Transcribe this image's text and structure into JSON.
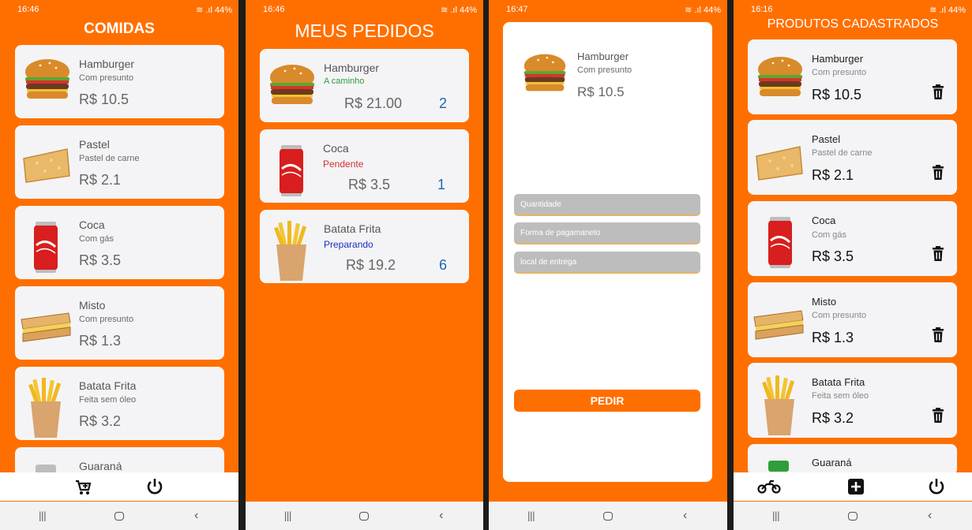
{
  "system_nav": {
    "recents": "|||",
    "back": "‹"
  },
  "screen1": {
    "time": "16:46",
    "signal": "≋ .ıl 44%",
    "title": "COMIDAS",
    "items": [
      {
        "name": "Hamburger",
        "desc": "Com presunto",
        "price": "R$ 10.5",
        "icon": "burger"
      },
      {
        "name": "Pastel",
        "desc": "Pastel de carne",
        "price": "R$ 2.1",
        "icon": "pastel"
      },
      {
        "name": "Coca",
        "desc": "Com gás",
        "price": "R$ 3.5",
        "icon": "soda-can"
      },
      {
        "name": "Misto",
        "desc": "Com presunto",
        "price": "R$ 1.3",
        "icon": "sandwich"
      },
      {
        "name": "Batata Frita",
        "desc": "Feita sem óleo",
        "price": "R$ 3.2",
        "icon": "fries"
      },
      {
        "name": "Guaraná",
        "icon": "soda-can-green"
      }
    ],
    "bottom_icons": [
      "cart-add-icon",
      "power-icon"
    ]
  },
  "screen2": {
    "time": "16:46",
    "signal": "≋ .ıl 44%",
    "title": "MEUS PEDIDOS",
    "orders": [
      {
        "name": "Hamburger",
        "status": "A caminho",
        "status_color": "#2e9e3a",
        "price": "R$ 21.00",
        "qty": "2",
        "icon": "burger"
      },
      {
        "name": "Coca",
        "status": "Pendente",
        "status_color": "#d32f2f",
        "price": "R$ 3.5",
        "qty": "1",
        "icon": "soda-can"
      },
      {
        "name": "Batata Frita",
        "status": "Preparando",
        "status_color": "#1a2fbf",
        "price": "R$ 19.2",
        "qty": "6",
        "icon": "fries"
      }
    ]
  },
  "screen3": {
    "time": "16:47",
    "signal": "≋ .ıl 44%",
    "product": {
      "name": "Hamburger",
      "desc": "Com presunto",
      "price": "R$ 10.5",
      "icon": "burger"
    },
    "fields": {
      "quantidade": "Quantidade",
      "pagamento": "Forma de pagamaneto",
      "local": "local de entrega"
    },
    "button": "PEDIR"
  },
  "screen4": {
    "time": "16:16",
    "signal": "≋ .ıl 44%",
    "title": "PRODUTOS CADASTRADOS",
    "items": [
      {
        "name": "Hamburger",
        "desc": "Com presunto",
        "price": "R$ 10.5",
        "icon": "burger"
      },
      {
        "name": "Pastel",
        "desc": "Pastel de carne",
        "price": "R$ 2.1",
        "icon": "pastel"
      },
      {
        "name": "Coca",
        "desc": "Com gás",
        "price": "R$ 3.5",
        "icon": "soda-can"
      },
      {
        "name": "Misto",
        "desc": "Com presunto",
        "price": "R$ 1.3",
        "icon": "sandwich"
      },
      {
        "name": "Batata Frita",
        "desc": "Feita sem óleo",
        "price": "R$ 3.2",
        "icon": "fries"
      },
      {
        "name": "Guaraná",
        "icon": "soda-can-green"
      }
    ],
    "bottom_icons": [
      "motorcycle-icon",
      "add-box-icon",
      "power-icon"
    ]
  },
  "colors": {
    "brand": "#ff6f00",
    "card": "#f4f4f6"
  }
}
